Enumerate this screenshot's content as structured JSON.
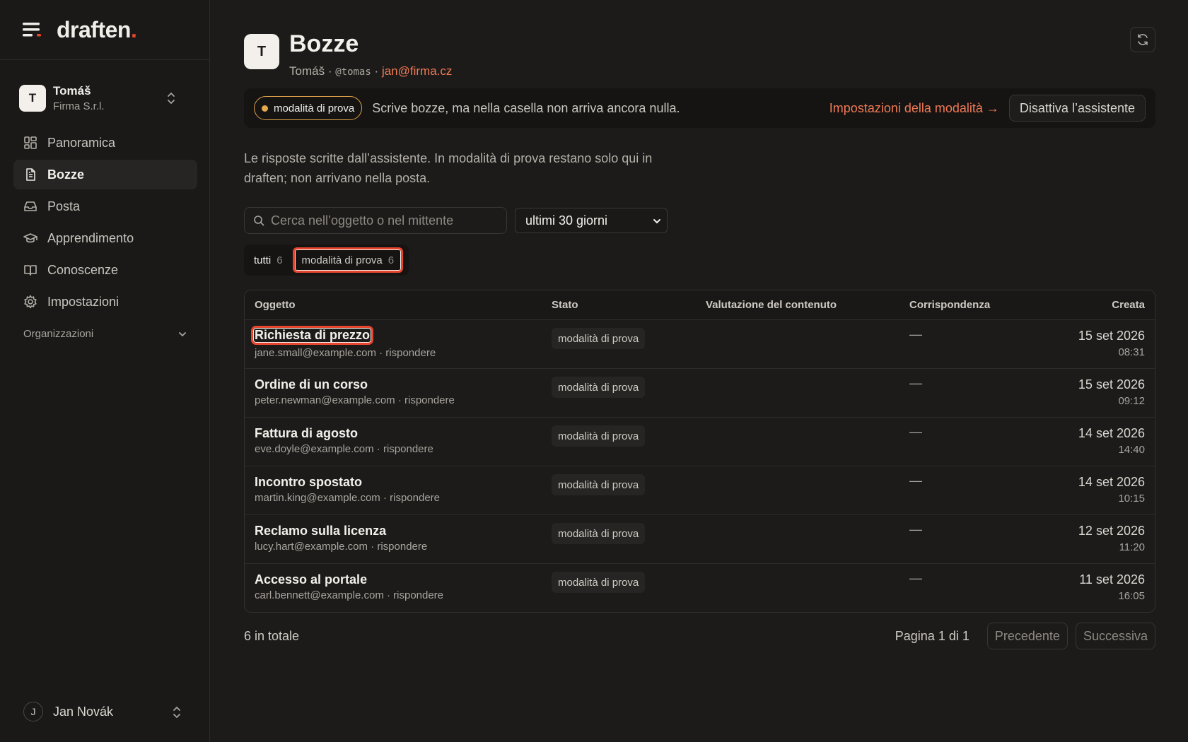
{
  "brand": {
    "logo": "draften",
    "logo_dot": "."
  },
  "workspace": {
    "avatar": "T",
    "name": "Tomáš",
    "company": "Firma S.r.l."
  },
  "nav": [
    {
      "label": "Panoramica",
      "icon": "grid-icon"
    },
    {
      "label": "Bozze",
      "icon": "document-icon",
      "active": true
    },
    {
      "label": "Posta",
      "icon": "inbox-icon"
    },
    {
      "label": "Apprendimento",
      "icon": "graduation-cap-icon"
    },
    {
      "label": "Conoscenze",
      "icon": "book-icon"
    },
    {
      "label": "Impostazioni",
      "icon": "gear-icon"
    }
  ],
  "orgs_label": "Organizzazioni",
  "user": {
    "avatar": "J",
    "name": "Jan Novák"
  },
  "header": {
    "avatar": "T",
    "title": "Bozze",
    "name": "Tomáš",
    "sep": "·",
    "handle": "@tomas",
    "email": "jan@firma.cz"
  },
  "banner": {
    "pill": "modalità di prova",
    "text": "Scrive bozze, ma nella casella non arriva ancora nulla.",
    "link": "Impostazioni della modalità →",
    "button": "Disattiva l’assistente"
  },
  "description": "Le risposte scritte dall’assistente. In modalità di prova restano solo qui in draften; non arrivano nella posta.",
  "search": {
    "placeholder": "Cerca nell’oggetto o nel mittente"
  },
  "range_select": "ultimi 30 giorni",
  "tabs": [
    {
      "label": "tutti",
      "count": "6"
    },
    {
      "label": "modalità di prova",
      "count": "6"
    }
  ],
  "table": {
    "columns": [
      "Oggetto",
      "Stato",
      "Valutazione del contenuto",
      "Corrispondenza",
      "Creata"
    ],
    "rows": [
      {
        "subject": "Richiesta di prezzo",
        "meta": "jane.small@example.com · rispondere",
        "state": "modalità di prova",
        "corr": "—",
        "date": "15 set 2026",
        "time": "08:31"
      },
      {
        "subject": "Ordine di un corso",
        "meta": "peter.newman@example.com · rispondere",
        "state": "modalità di prova",
        "corr": "—",
        "date": "15 set 2026",
        "time": "09:12"
      },
      {
        "subject": "Fattura di agosto",
        "meta": "eve.doyle@example.com · rispondere",
        "state": "modalità di prova",
        "corr": "—",
        "date": "14 set 2026",
        "time": "14:40"
      },
      {
        "subject": "Incontro spostato",
        "meta": "martin.king@example.com · rispondere",
        "state": "modalità di prova",
        "corr": "—",
        "date": "14 set 2026",
        "time": "10:15"
      },
      {
        "subject": "Reclamo sulla licenza",
        "meta": "lucy.hart@example.com · rispondere",
        "state": "modalità di prova",
        "corr": "—",
        "date": "12 set 2026",
        "time": "11:20"
      },
      {
        "subject": "Accesso al portale",
        "meta": "carl.bennett@example.com · rispondere",
        "state": "modalità di prova",
        "corr": "—",
        "date": "11 set 2026",
        "time": "16:05"
      }
    ]
  },
  "footer": {
    "total": "6 in totale",
    "page_info": "Pagina 1 di 1",
    "prev": "Precedente",
    "next": "Successiva"
  },
  "colors": {
    "accent": "#f07a55",
    "focus": "#e8452e",
    "test_dot": "#e5a84c"
  }
}
